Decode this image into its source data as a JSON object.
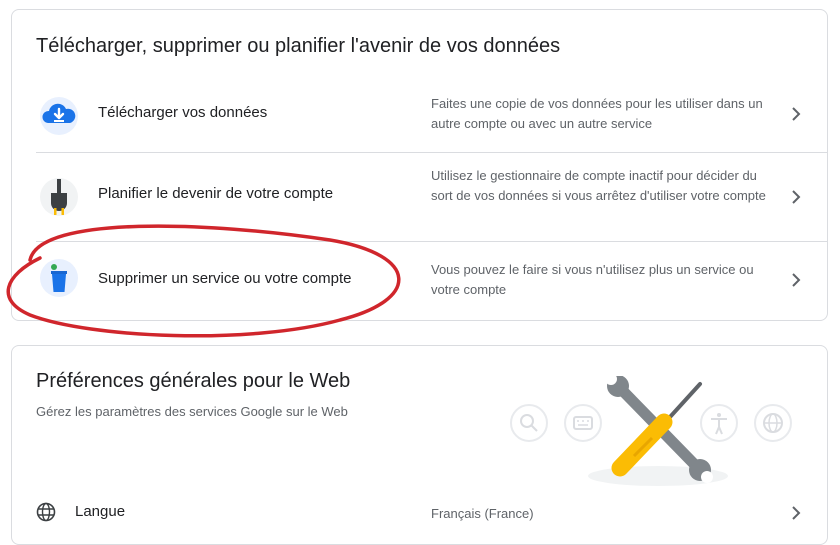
{
  "section_data": {
    "title": "Télécharger, supprimer ou planifier l'avenir de vos données",
    "rows": [
      {
        "label": "Télécharger vos données",
        "description": "Faites une copie de vos données pour les utiliser dans un autre compte ou avec un autre service",
        "icon": "cloud-download-icon"
      },
      {
        "label": "Planifier le devenir de votre compte",
        "description": "Utilisez le gestionnaire de compte inactif pour décider du sort de vos données si vous arrêtez d'utiliser votre compte",
        "icon": "power-plug-icon"
      },
      {
        "label": "Supprimer un service ou votre compte",
        "description": "Vous pouvez le faire si vous n'utilisez plus un service ou votre compte",
        "icon": "trash-bin-icon"
      }
    ]
  },
  "web_prefs": {
    "title": "Préférences générales pour le Web",
    "subtitle": "Gérez les paramètres des services Google sur le Web",
    "illustration_icons": [
      "search-icon",
      "keyboard-icon",
      "accessibility-icon",
      "globe-icon"
    ],
    "language": {
      "label": "Langue",
      "value": "Français (France)",
      "icon": "globe-icon"
    }
  },
  "colors": {
    "border": "#dadce0",
    "text_primary": "#202124",
    "text_secondary": "#5f6368",
    "google_blue": "#1a73e8",
    "annotation_red": "#d0262c",
    "screwdriver_yellow": "#fbbc04"
  }
}
